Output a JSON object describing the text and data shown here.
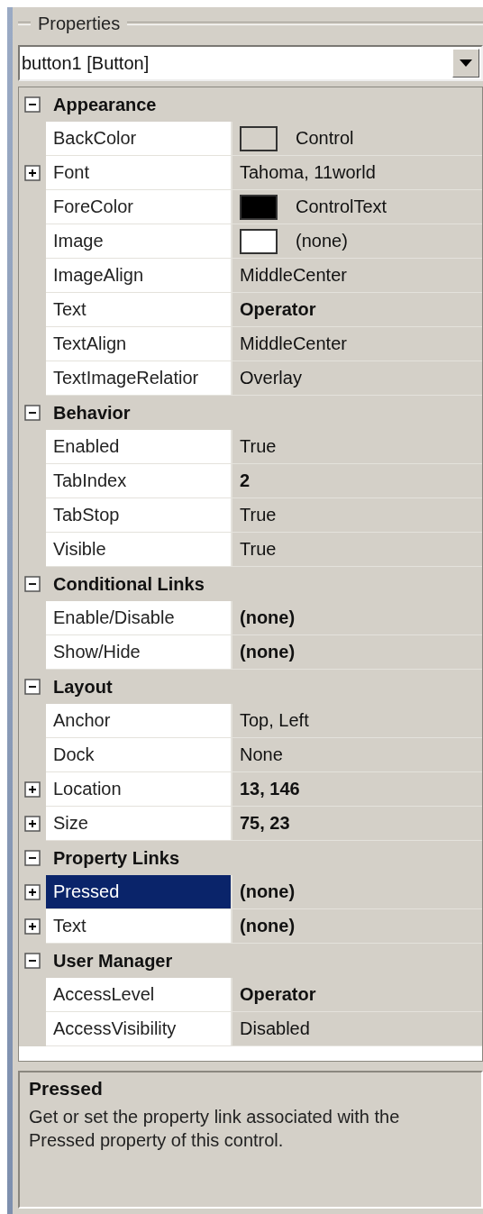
{
  "panel": {
    "title": "Properties"
  },
  "object_selector": {
    "value": "button1 [Button]"
  },
  "categories": [
    {
      "name": "Appearance",
      "expanded": true,
      "properties": [
        {
          "name": "BackColor",
          "value": "Control",
          "modified": false,
          "selected": false,
          "color": "#d4d0c8"
        },
        {
          "name": "Font",
          "value": "Tahoma, 11world",
          "modified": false,
          "selected": false,
          "expanded": false
        },
        {
          "name": "ForeColor",
          "value": "ControlText",
          "modified": false,
          "selected": false,
          "color": "#000000"
        },
        {
          "name": "Image",
          "value": "(none)",
          "modified": false,
          "selected": false,
          "color": "#ffffff"
        },
        {
          "name": "ImageAlign",
          "value": "MiddleCenter",
          "modified": false,
          "selected": false
        },
        {
          "name": "Text",
          "value": "Operator",
          "modified": true,
          "selected": false
        },
        {
          "name": "TextAlign",
          "value": "MiddleCenter",
          "modified": false,
          "selected": false
        },
        {
          "name": "TextImageRelatior",
          "value": "Overlay",
          "modified": false,
          "selected": false
        }
      ]
    },
    {
      "name": "Behavior",
      "expanded": true,
      "properties": [
        {
          "name": "Enabled",
          "value": "True",
          "modified": false,
          "selected": false
        },
        {
          "name": "TabIndex",
          "value": "2",
          "modified": true,
          "selected": false
        },
        {
          "name": "TabStop",
          "value": "True",
          "modified": false,
          "selected": false
        },
        {
          "name": "Visible",
          "value": "True",
          "modified": false,
          "selected": false
        }
      ]
    },
    {
      "name": "Conditional Links",
      "expanded": true,
      "properties": [
        {
          "name": "Enable/Disable",
          "value": "(none)",
          "modified": true,
          "selected": false
        },
        {
          "name": "Show/Hide",
          "value": "(none)",
          "modified": true,
          "selected": false
        }
      ]
    },
    {
      "name": "Layout",
      "expanded": true,
      "properties": [
        {
          "name": "Anchor",
          "value": "Top, Left",
          "modified": false,
          "selected": false
        },
        {
          "name": "Dock",
          "value": "None",
          "modified": false,
          "selected": false
        },
        {
          "name": "Location",
          "value": "13, 146",
          "modified": true,
          "selected": false,
          "expanded": false
        },
        {
          "name": "Size",
          "value": "75, 23",
          "modified": true,
          "selected": false,
          "expanded": false
        }
      ]
    },
    {
      "name": "Property Links",
      "expanded": true,
      "properties": [
        {
          "name": "Pressed",
          "value": "(none)",
          "modified": true,
          "selected": true,
          "expanded": false
        },
        {
          "name": "Text",
          "value": "(none)",
          "modified": true,
          "selected": false,
          "expanded": false
        }
      ]
    },
    {
      "name": "User Manager",
      "expanded": true,
      "properties": [
        {
          "name": "AccessLevel",
          "value": "Operator",
          "modified": true,
          "selected": false
        },
        {
          "name": "AccessVisibility",
          "value": "Disabled",
          "modified": false,
          "selected": false
        }
      ]
    }
  ],
  "description": {
    "title": "Pressed",
    "text": "Get or set the property link associated with the Pressed property of this control."
  }
}
